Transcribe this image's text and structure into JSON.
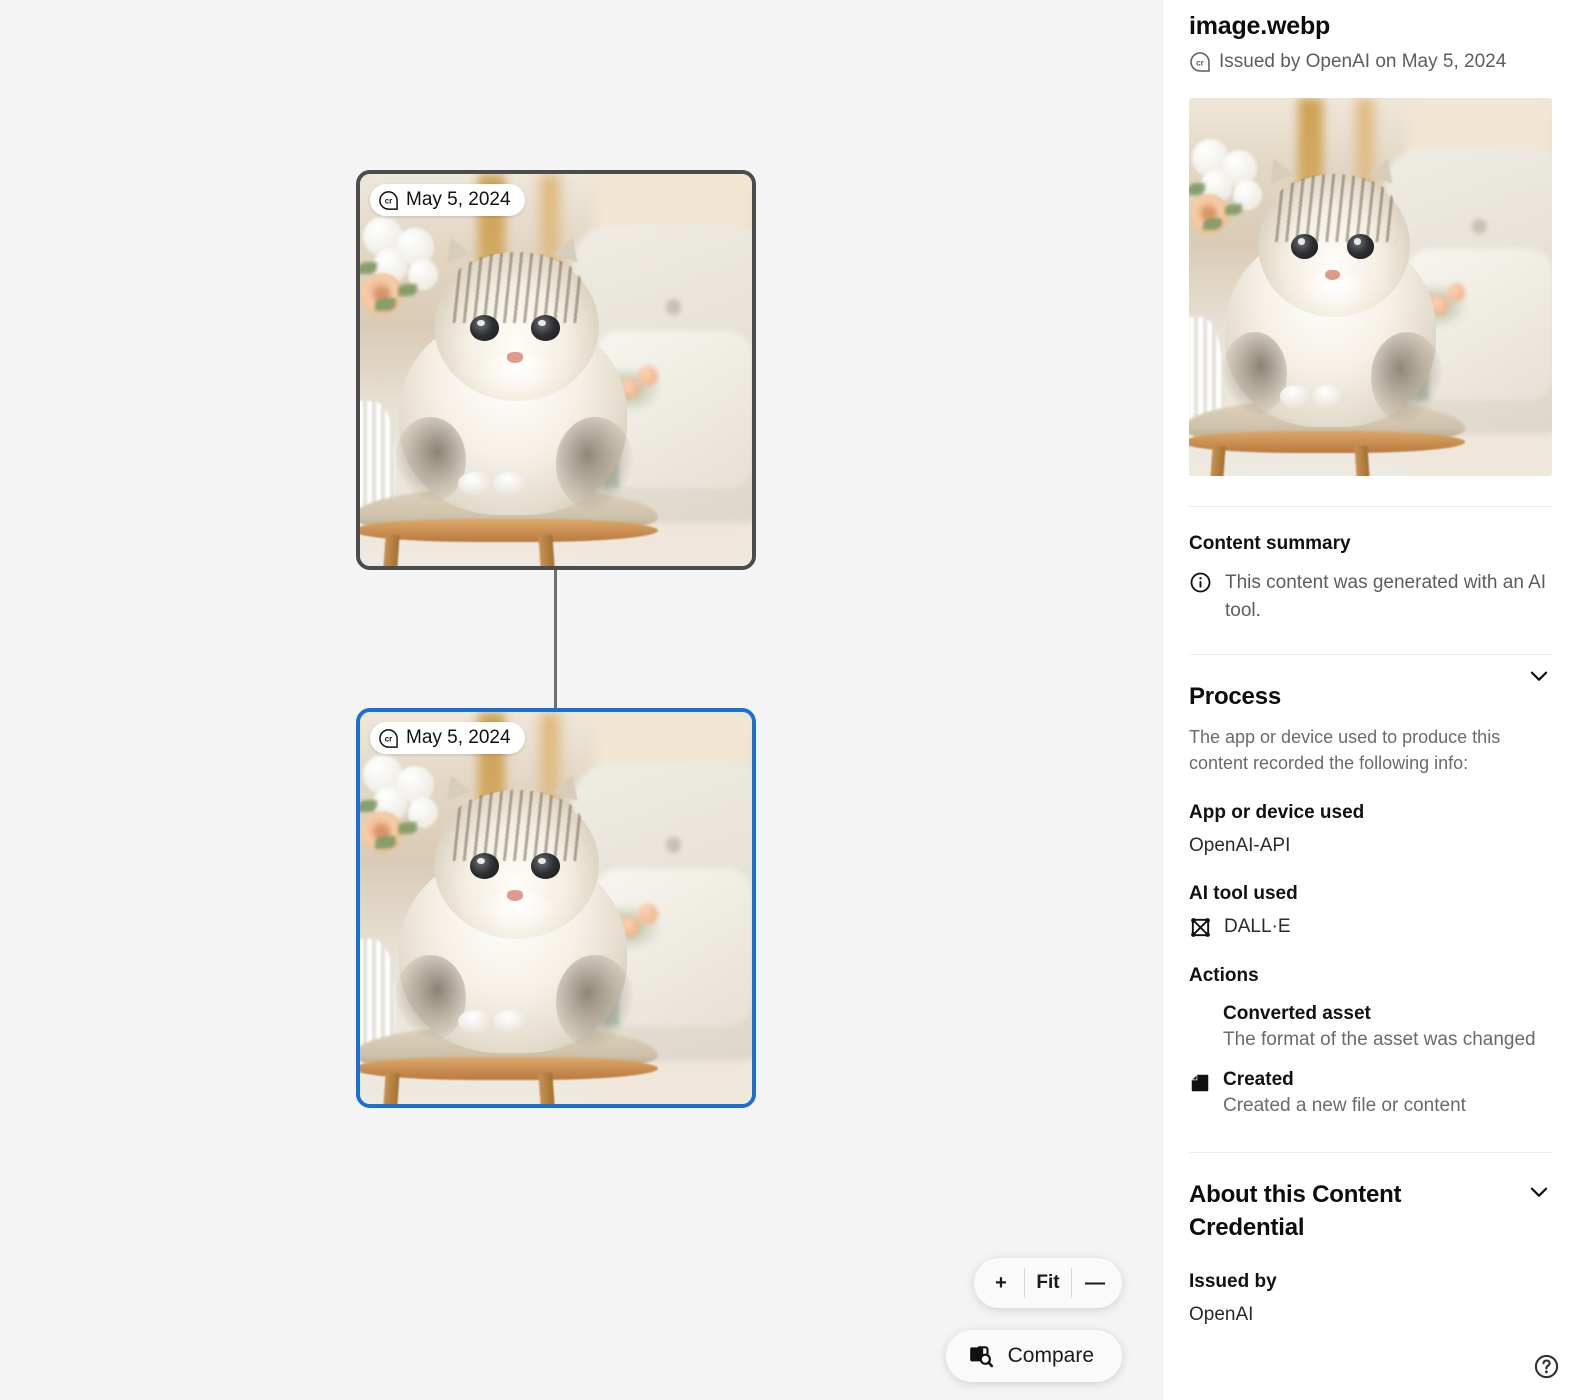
{
  "colors": {
    "canvas_bg": "#f4f4f4",
    "selected_node_border": "#1a6fd4",
    "node_border": "#4c4c4c",
    "connector": "#6e6e6e",
    "sidebar_bg": "#ffffff",
    "text_primary": "#111111",
    "text_secondary": "#6b6b6b"
  },
  "canvas": {
    "nodes": [
      {
        "badge_label": "May 5, 2024",
        "badge_icon": "cr-icon",
        "selected": false
      },
      {
        "badge_label": "May 5, 2024",
        "badge_icon": "cr-icon",
        "selected": true
      }
    ],
    "zoom_controls": {
      "zoom_in_label": "+",
      "fit_label": "Fit",
      "zoom_out_label": "—"
    },
    "compare_button": {
      "label": "Compare",
      "icon": "compare-icon"
    }
  },
  "sidebar": {
    "title": "image.webp",
    "issuer_line": "Issued by OpenAI on May 5, 2024",
    "issuer_icon": "cr-icon",
    "content_summary": {
      "heading": "Content summary",
      "icon": "info-icon",
      "text": "This content was generated with an AI tool."
    },
    "process": {
      "heading": "Process",
      "chevron": "chevron-down-icon",
      "description": "The app or device used to produce this content recorded the following info:",
      "app_label": "App or device used",
      "app_value": "OpenAI-API",
      "ai_tool_label": "AI tool used",
      "ai_tool_value": "DALL·E",
      "ai_tool_icon": "dalle-icon",
      "actions_label": "Actions",
      "actions": [
        {
          "name": "Converted asset",
          "description": "The format of the asset was changed",
          "icon": null
        },
        {
          "name": "Created",
          "description": "Created a new file or content",
          "icon": "created-icon"
        }
      ]
    },
    "about": {
      "heading": "About this Content Credential",
      "chevron": "chevron-down-icon",
      "issued_by_label": "Issued by",
      "issued_by_value": "OpenAI"
    },
    "help_icon": "help-circle-icon"
  }
}
